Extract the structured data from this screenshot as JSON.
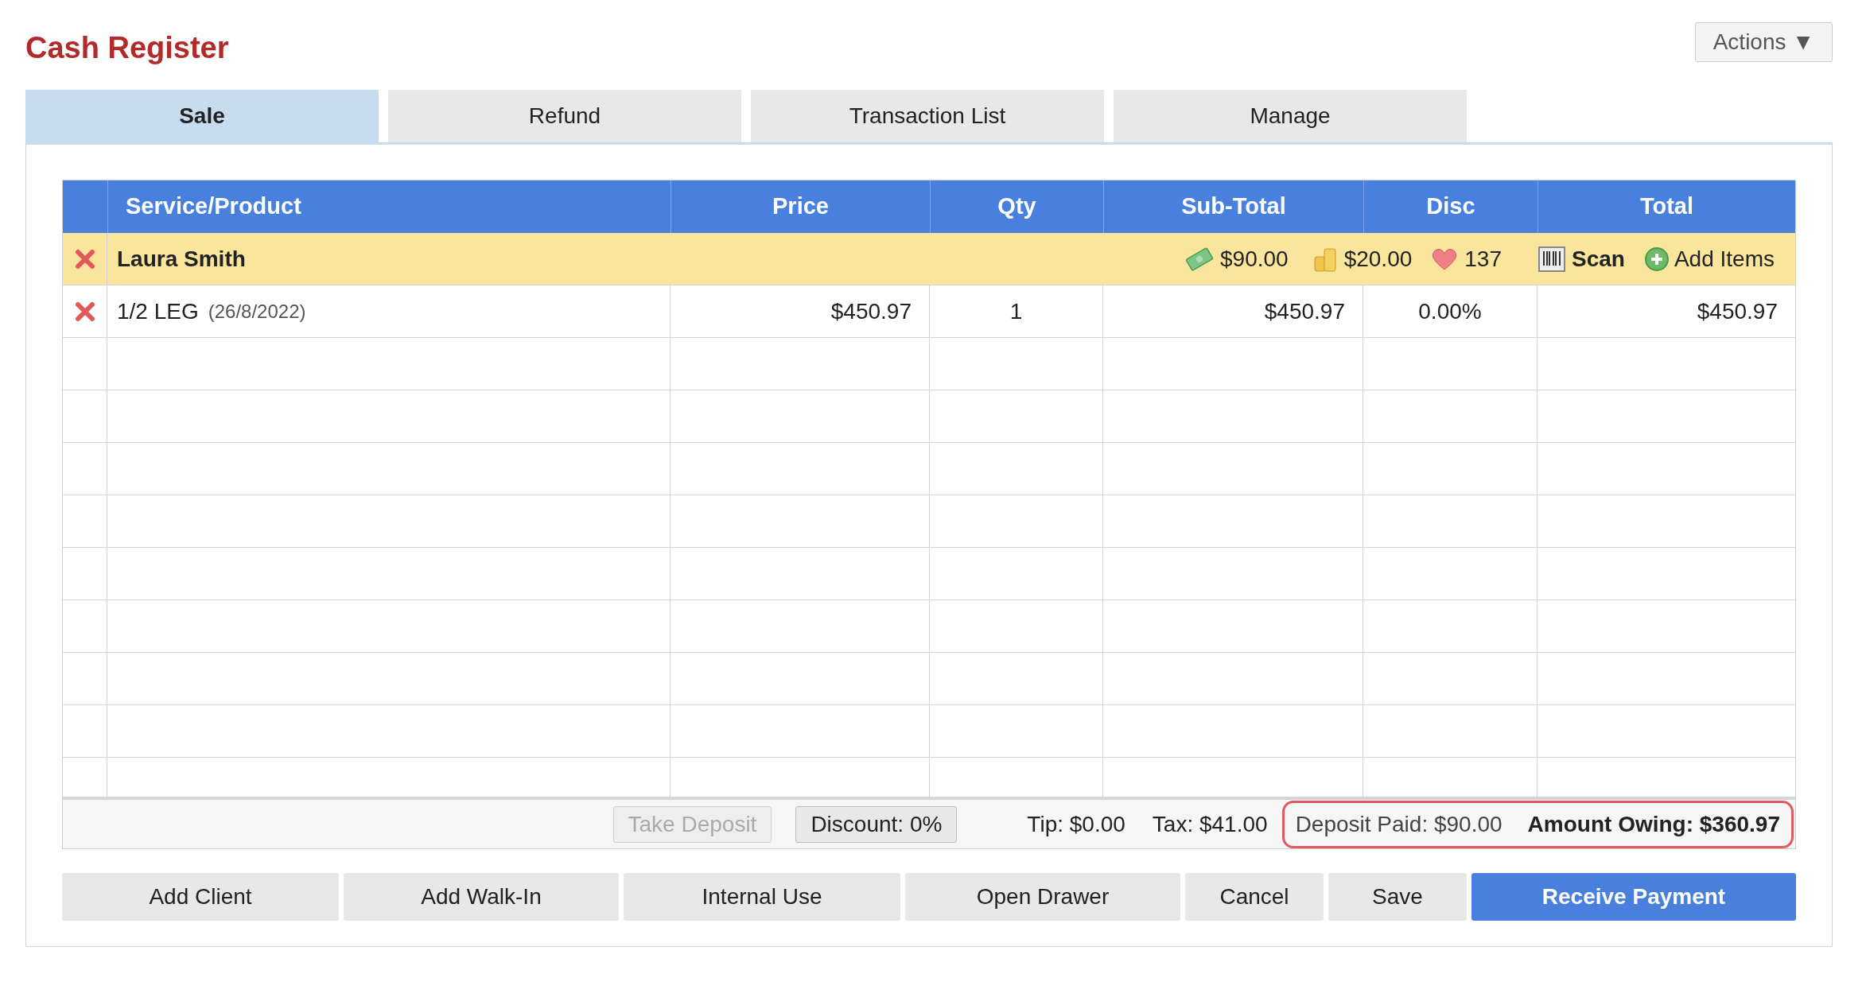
{
  "title": "Cash Register",
  "actions_button": {
    "label": "Actions ▼"
  },
  "tabs": [
    {
      "label": "Sale",
      "selected": true
    },
    {
      "label": "Refund",
      "selected": false
    },
    {
      "label": "Transaction List",
      "selected": false
    },
    {
      "label": "Manage",
      "selected": false
    }
  ],
  "table": {
    "columns": [
      "Service/Product",
      "Price",
      "Qty",
      "Sub-Total",
      "Disc",
      "Total"
    ],
    "client_row": {
      "name": "Laura Smith",
      "cash_credit": "$90.00",
      "account_credit": "$20.00",
      "loyalty_points": "137",
      "scan": "Scan",
      "add_items": "Add Items"
    },
    "rows": [
      {
        "item": "1/2 LEG",
        "date": "(26/8/2022)",
        "price": "$450.97",
        "qty": "1",
        "subtotal": "$450.97",
        "disc": "0.00%",
        "total": "$450.97"
      }
    ]
  },
  "summary": {
    "take_deposit": {
      "label": "Take Deposit",
      "disabled": true
    },
    "discount": {
      "label": "Discount: 0%",
      "disabled": false
    },
    "tip": "Tip: $0.00",
    "tax": "Tax: $41.00",
    "deposit_paid": "Deposit Paid: $90.00",
    "amount_owing": "Amount Owing: $360.97"
  },
  "buttons": [
    {
      "label": "Add Client",
      "kind": "default"
    },
    {
      "label": "Add Walk-In",
      "kind": "default"
    },
    {
      "label": "Internal Use",
      "kind": "default"
    },
    {
      "label": "Open Drawer",
      "kind": "default"
    },
    {
      "label": "Cancel",
      "kind": "default"
    },
    {
      "label": "Save",
      "kind": "default"
    },
    {
      "label": "Receive Payment",
      "kind": "primary"
    }
  ]
}
